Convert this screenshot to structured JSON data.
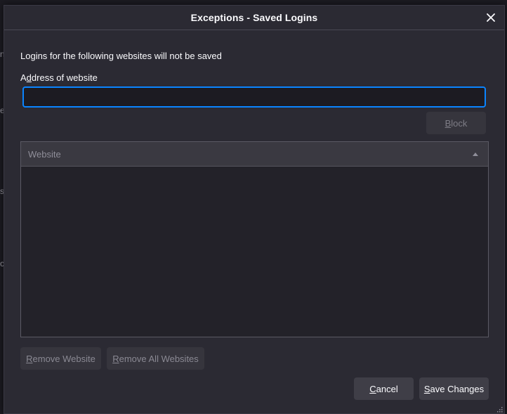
{
  "dialog": {
    "title": "Exceptions - Saved Logins",
    "close_icon": "close-icon"
  },
  "form": {
    "intro": "Logins for the following websites will not be saved",
    "address_label_prefix": "A",
    "address_label_mnemonic": "d",
    "address_label_rest": "dress of website",
    "address_value": "",
    "block_mnemonic": "B",
    "block_rest": "lock"
  },
  "table": {
    "columns": [
      "Website"
    ],
    "sort_icon": "sort-ascending-icon",
    "rows": []
  },
  "actions": {
    "remove_mnemonic": "R",
    "remove_rest": "emove Website",
    "remove_all_mnemonic": "R",
    "remove_all_rest": "emove All Websites",
    "cancel_mnemonic": "C",
    "cancel_rest": "ancel",
    "save_mnemonic": "S",
    "save_rest": "ave Changes"
  },
  "colors": {
    "accent": "#0a84ff",
    "dialog_bg": "#2b2a33",
    "text": "#fbfbfe"
  }
}
